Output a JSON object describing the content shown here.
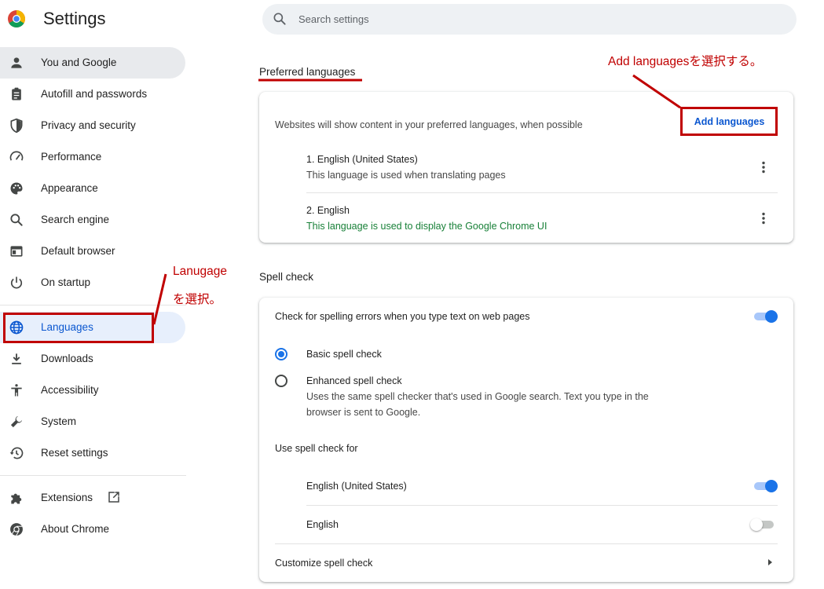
{
  "header": {
    "title": "Settings",
    "search_placeholder": "Search settings",
    "search_value": ""
  },
  "sidebar": {
    "items": [
      {
        "label": "You and Google",
        "icon": "person-icon"
      },
      {
        "label": "Autofill and passwords",
        "icon": "clipboard-icon"
      },
      {
        "label": "Privacy and security",
        "icon": "shield-icon"
      },
      {
        "label": "Performance",
        "icon": "speedometer-icon"
      },
      {
        "label": "Appearance",
        "icon": "palette-icon"
      },
      {
        "label": "Search engine",
        "icon": "search-icon"
      },
      {
        "label": "Default browser",
        "icon": "browser-icon"
      },
      {
        "label": "On startup",
        "icon": "power-icon"
      },
      {
        "label": "Languages",
        "icon": "globe-icon"
      },
      {
        "label": "Downloads",
        "icon": "download-icon"
      },
      {
        "label": "Accessibility",
        "icon": "accessibility-icon"
      },
      {
        "label": "System",
        "icon": "wrench-icon"
      },
      {
        "label": "Reset settings",
        "icon": "history-icon"
      },
      {
        "label": "Extensions",
        "icon": "puzzle-icon"
      },
      {
        "label": "About Chrome",
        "icon": "chrome-icon"
      }
    ]
  },
  "preferred_languages": {
    "section_title": "Preferred languages",
    "description": "Websites will show content in your preferred languages, when possible",
    "add_button": "Add languages",
    "languages": [
      {
        "name": "1. English (United States)",
        "note": "This language is used when translating pages"
      },
      {
        "name": "2. English",
        "note": "This language is used to display the Google Chrome UI"
      }
    ]
  },
  "spell_check": {
    "section_title": "Spell check",
    "main_toggle_label": "Check for spelling errors when you type text on web pages",
    "main_toggle_on": true,
    "basic_label": "Basic spell check",
    "enhanced_label": "Enhanced spell check",
    "enhanced_desc_line1": "Uses the same spell checker that's used in Google search. Text you type in the",
    "enhanced_desc_line2": "browser is sent to Google.",
    "selected_mode": "basic",
    "use_for_label": "Use spell check for",
    "use_for": [
      {
        "name": "English (United States)",
        "enabled": true
      },
      {
        "name": "English",
        "enabled": false
      }
    ],
    "customize_label": "Customize spell check"
  },
  "annotations": {
    "add_languages_note": "Add languagesを選択する。",
    "languages_note_line1": "Lanugage",
    "languages_note_line2": "を選択。"
  },
  "colors": {
    "accent": "#1a73e8",
    "link": "#0b57d0",
    "annotation_red": "#c00000",
    "ui_note_green": "#188038"
  }
}
